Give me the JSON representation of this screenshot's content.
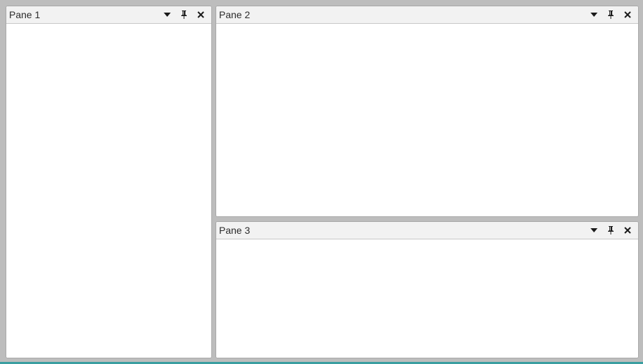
{
  "panes": [
    {
      "title": "Pane 1"
    },
    {
      "title": "Pane 2"
    },
    {
      "title": "Pane 3"
    }
  ],
  "icons": {
    "menu": "dropdown-arrow-icon",
    "pin": "pin-icon",
    "close": "close-icon"
  },
  "colors": {
    "background": "#bdbdbd",
    "header": "#f2f2f2",
    "accent": "#3a9ea0"
  }
}
